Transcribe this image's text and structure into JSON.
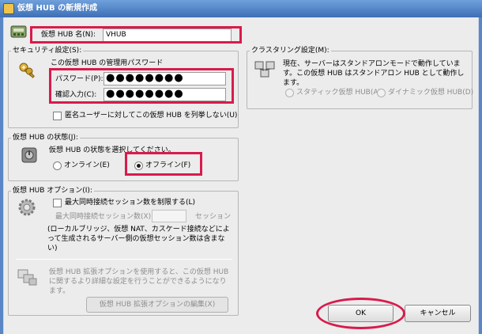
{
  "window": {
    "title": "仮想 HUB の新規作成"
  },
  "hub_name": {
    "label": "仮想 HUB 名(N):",
    "value": "VHUB"
  },
  "security": {
    "group_label": "セキュリティ設定(S):",
    "password_heading": "この仮想 HUB の管理用パスワード",
    "password_label": "パスワード(P):",
    "password_value": "●●●●●●●●",
    "confirm_label": "確認入力(C):",
    "confirm_value": "●●●●●●●●",
    "anonymous_checkbox": "匿名ユーザーに対してこの仮想 HUB を列挙しない(U)"
  },
  "clustering": {
    "group_label": "クラスタリング設定(M):",
    "description": "現在、サーバーはスタンドアロンモードで動作しています。この仮想 HUB はスタンドアロン HUB として動作します。",
    "static_label": "スタティック仮想 HUB(A)",
    "dynamic_label": "ダイナミック仮想 HUB(D)"
  },
  "hub_state": {
    "group_label": "仮想 HUB の状態(J):",
    "prompt": "仮想 HUB の状態を選択してください。",
    "online_label": "オンライン(E)",
    "offline_label": "オフライン(F)"
  },
  "hub_options": {
    "group_label": "仮想 HUB オプション(I):",
    "limit_checkbox": "最大同時接続セッション数を制限する(L)",
    "max_sessions_label": "最大同時接続セッション数(X):",
    "sessions_unit": "セッション",
    "note": "(ローカルブリッジ、仮想 NAT、カスケード接続などによって生成されるサーバー側の仮想セッション数は含まない)",
    "extended_description": "仮想 HUB 拡張オプションを使用すると、この仮想 HUB に関するより詳細な設定を行うことができるようになります。",
    "edit_button": "仮想 HUB 拡張オプションの編集(X)"
  },
  "buttons": {
    "ok": "OK",
    "cancel": "キャンセル"
  },
  "colors": {
    "highlight": "#d81b4c",
    "titlebar": "#3e6fb6"
  }
}
